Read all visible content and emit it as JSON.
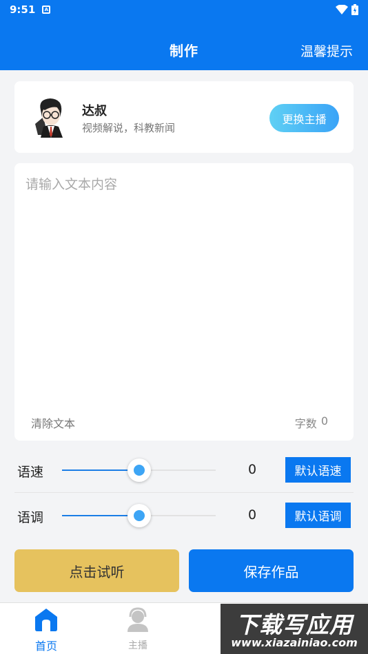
{
  "status_bar": {
    "time": "9:51",
    "notification_glyph": "A"
  },
  "header": {
    "title": "制作",
    "tips_label": "温馨提示"
  },
  "anchor": {
    "name": "达叔",
    "description": "视频解说，科教新闻",
    "change_button": "更换主播"
  },
  "editor": {
    "placeholder": "请输入文本内容",
    "value": "",
    "clear_label": "清除文本",
    "count_label": "字数",
    "count_value": "0"
  },
  "speed": {
    "label": "语速",
    "value": "0",
    "default_button": "默认语速",
    "level_percent": 50
  },
  "pitch": {
    "label": "语调",
    "value": "0",
    "default_button": "默认语调",
    "level_percent": 50
  },
  "actions": {
    "listen_button": "点击试听",
    "save_button": "保存作品"
  },
  "tabbar": {
    "items": [
      {
        "label": "首页",
        "icon": "home-icon",
        "active": true
      },
      {
        "label": "主播",
        "icon": "person-headset-icon",
        "active": false
      }
    ]
  },
  "watermark": {
    "main": "下载写应用",
    "url": "www.xiazainiao.com"
  },
  "colors": {
    "primary": "#0a78f0",
    "listen": "#e6c25e",
    "accent_gradient_start": "#5fd0f4",
    "accent_gradient_end": "#3aa3f7"
  }
}
